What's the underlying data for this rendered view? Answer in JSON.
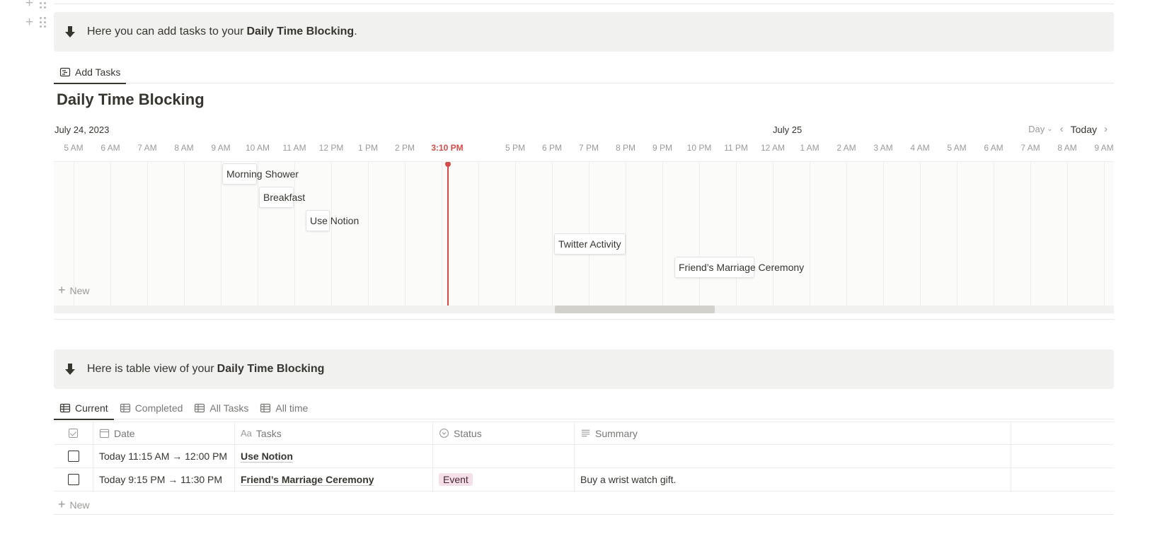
{
  "callout_top": {
    "text": "Here you can add tasks to your",
    "bold": "Daily Time Blocking",
    "tail": "."
  },
  "timeline_view_tab": {
    "label": "Add Tasks"
  },
  "database": {
    "title": "Daily Time Blocking"
  },
  "timeline": {
    "date_left": "July 24, 2023",
    "date_mid": "July 25",
    "scale": "Day",
    "today_label": "Today",
    "now_label": "3:10 PM",
    "hours": [
      "5 AM",
      "6 AM",
      "7 AM",
      "8 AM",
      "9 AM",
      "10 AM",
      "11 AM",
      "12 PM",
      "1 PM",
      "2 PM",
      "5 PM",
      "6 PM",
      "7 PM",
      "8 PM",
      "9 PM",
      "10 PM",
      "11 PM",
      "12 AM",
      "1 AM",
      "2 AM",
      "3 AM",
      "4 AM",
      "5 AM",
      "6 AM",
      "7 AM",
      "8 AM",
      "9 AM"
    ],
    "events": [
      {
        "name": "Morning Shower"
      },
      {
        "name": "Breakfast"
      },
      {
        "name": "Use Notion"
      },
      {
        "name": "Twitter Activity"
      },
      {
        "name": "Friend’s Marriage Ceremony"
      }
    ],
    "new_label": "New"
  },
  "callout_table": {
    "text": "Here is table view of your",
    "bold": "Daily Time Blocking"
  },
  "table_tabs": [
    "Current",
    "Completed",
    "All Tasks",
    "All time"
  ],
  "table": {
    "headers": {
      "date": "Date",
      "tasks_prefix": "Aa",
      "tasks": "Tasks",
      "status": "Status",
      "summary": "Summary"
    },
    "rows": [
      {
        "date": "Today 11:15 AM → 12:00 PM",
        "task": "Use Notion",
        "status": "",
        "summary": ""
      },
      {
        "date": "Today 9:15 PM → 11:30 PM",
        "task": "Friend’s Marriage Ceremony",
        "status": "Event",
        "summary": "Buy a wrist watch gift."
      }
    ],
    "new_label": "New"
  },
  "colors": {
    "now_line": "#d44c47",
    "event_badge_bg": "#f5e0e9",
    "callout_bg": "#f1f1ef"
  }
}
